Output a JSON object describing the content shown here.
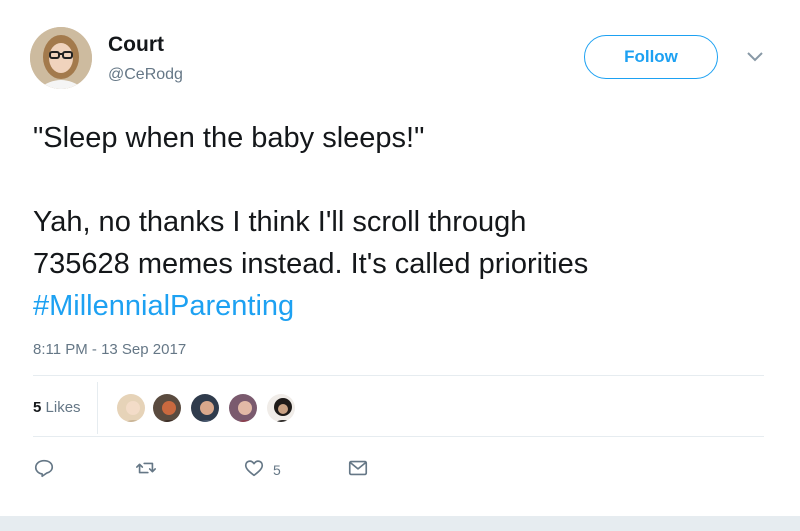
{
  "author": {
    "name": "Court",
    "handle": "@CeRodg",
    "avatar_icon": "user-photo-avatar"
  },
  "follow_button": {
    "label": "Follow"
  },
  "tweet": {
    "line1": "\"Sleep when the baby sleeps!\"",
    "line2": "Yah, no thanks I think I'll scroll through",
    "line3": "735628 memes instead. It's called priorities",
    "hashtag": "#MillennialParenting"
  },
  "timestamp": "8:11 PM - 13 Sep 2017",
  "likes": {
    "count": "5",
    "label": "Likes"
  },
  "actions": {
    "reply_icon": "reply-icon",
    "retweet_icon": "retweet-icon",
    "like_icon": "heart-icon",
    "like_count": "5",
    "message_icon": "envelope-icon"
  },
  "colors": {
    "accent": "#1da1f2",
    "text": "#14171a",
    "muted": "#657786",
    "divider": "#e6ecf0"
  }
}
